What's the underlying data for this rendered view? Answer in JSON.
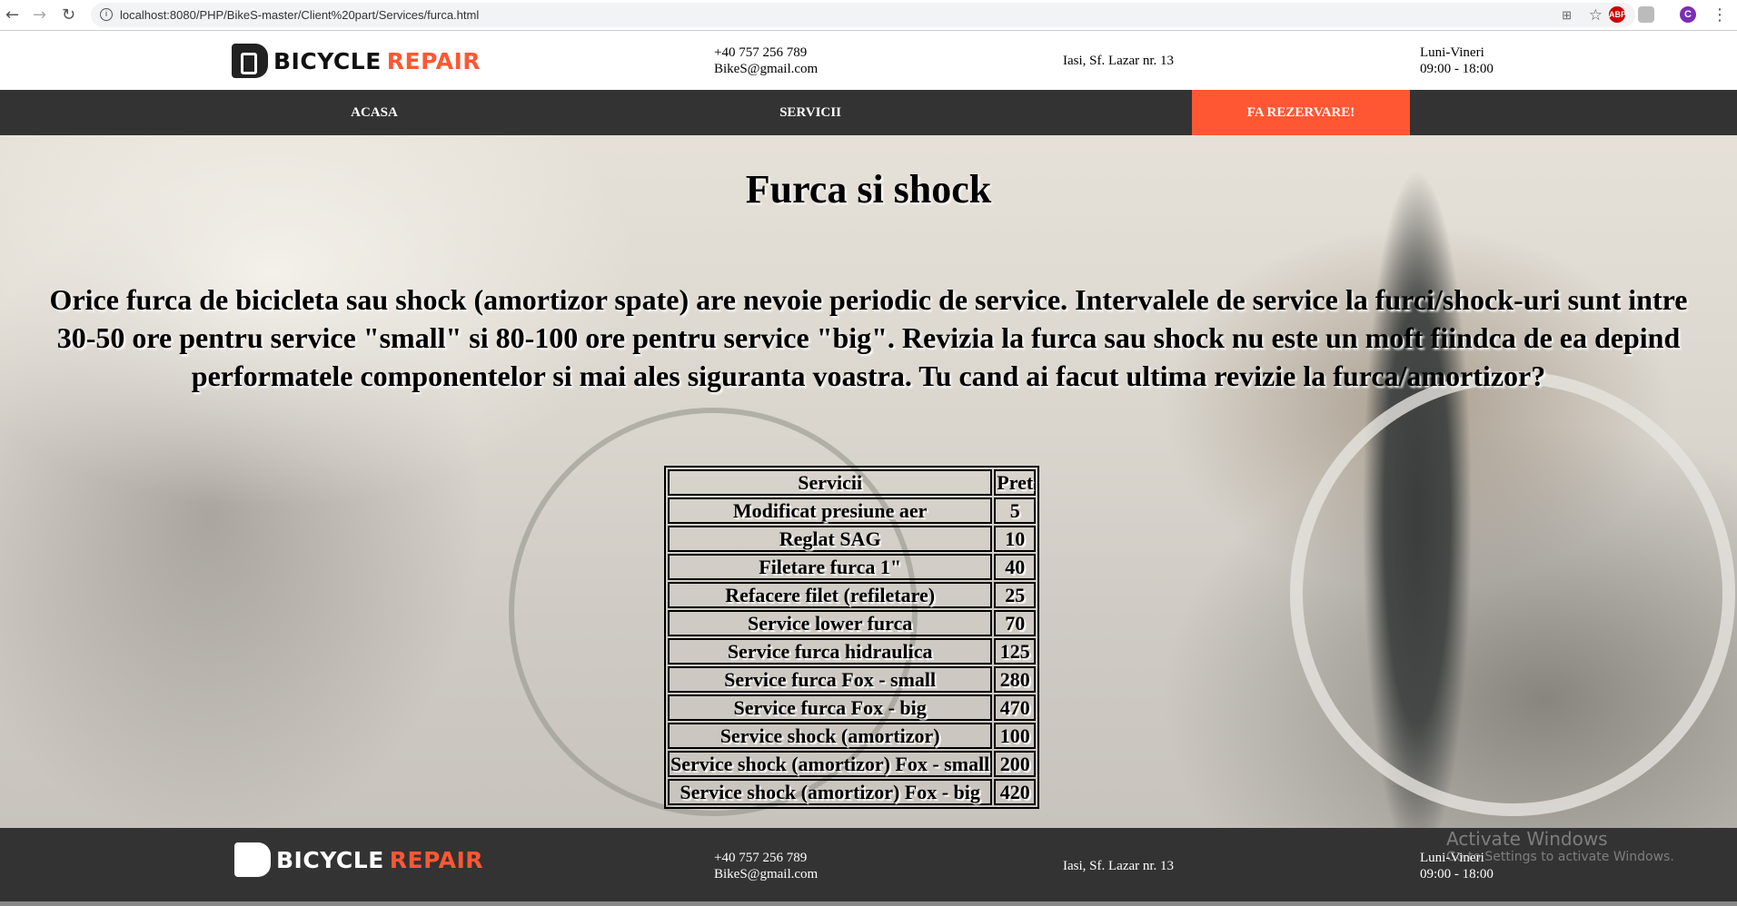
{
  "browser": {
    "url": "localhost:8080/PHP/BikeS-master/Client%20part/Services/furca.html",
    "profile_initial": "C",
    "abp": "ABP"
  },
  "brand": {
    "word1": "BICYCLE",
    "word2": "REPAIR",
    "accent": "#ff5733"
  },
  "contact": {
    "phone": "+40 757 256 789",
    "email": "BikeS@gmail.com",
    "address": "Iasi, Sf. Lazar nr. 13",
    "days": "Luni-Vineri",
    "hours": "09:00 - 18:00"
  },
  "nav": {
    "items": [
      "ACASA",
      "SERVICII"
    ],
    "cta": "FA REZERVARE!"
  },
  "main": {
    "title": "Furca si shock",
    "description": "Orice furca de bicicleta sau shock (amortizor spate) are nevoie periodic de service. Intervalele de service la furci/shock-uri sunt intre 30-50 ore pentru service \"small\" si 80-100 ore pentru service \"big\". Revizia la furca sau shock nu este un moft fiindca de ea depind performatele componentelor si mai ales siguranta voastra. Tu cand ai facut ultima revizie la furca/amortizor?"
  },
  "table": {
    "headers": [
      "Servicii",
      "Pret"
    ],
    "rows": [
      [
        "Modificat presiune aer",
        "5"
      ],
      [
        "Reglat SAG",
        "10"
      ],
      [
        "Filetare furca 1\"",
        "40"
      ],
      [
        "Refacere filet (refiletare)",
        "25"
      ],
      [
        "Service lower furca",
        "70"
      ],
      [
        "Service furca hidraulica",
        "125"
      ],
      [
        "Service furca Fox - small",
        "280"
      ],
      [
        "Service furca Fox - big",
        "470"
      ],
      [
        "Service shock (amortizor)",
        "100"
      ],
      [
        "Service shock (amortizor) Fox - small",
        "200"
      ],
      [
        "Service shock (amortizor) Fox - big",
        "420"
      ]
    ]
  },
  "watermark": {
    "title": "Activate Windows",
    "subtitle": "Go to Settings to activate Windows."
  }
}
